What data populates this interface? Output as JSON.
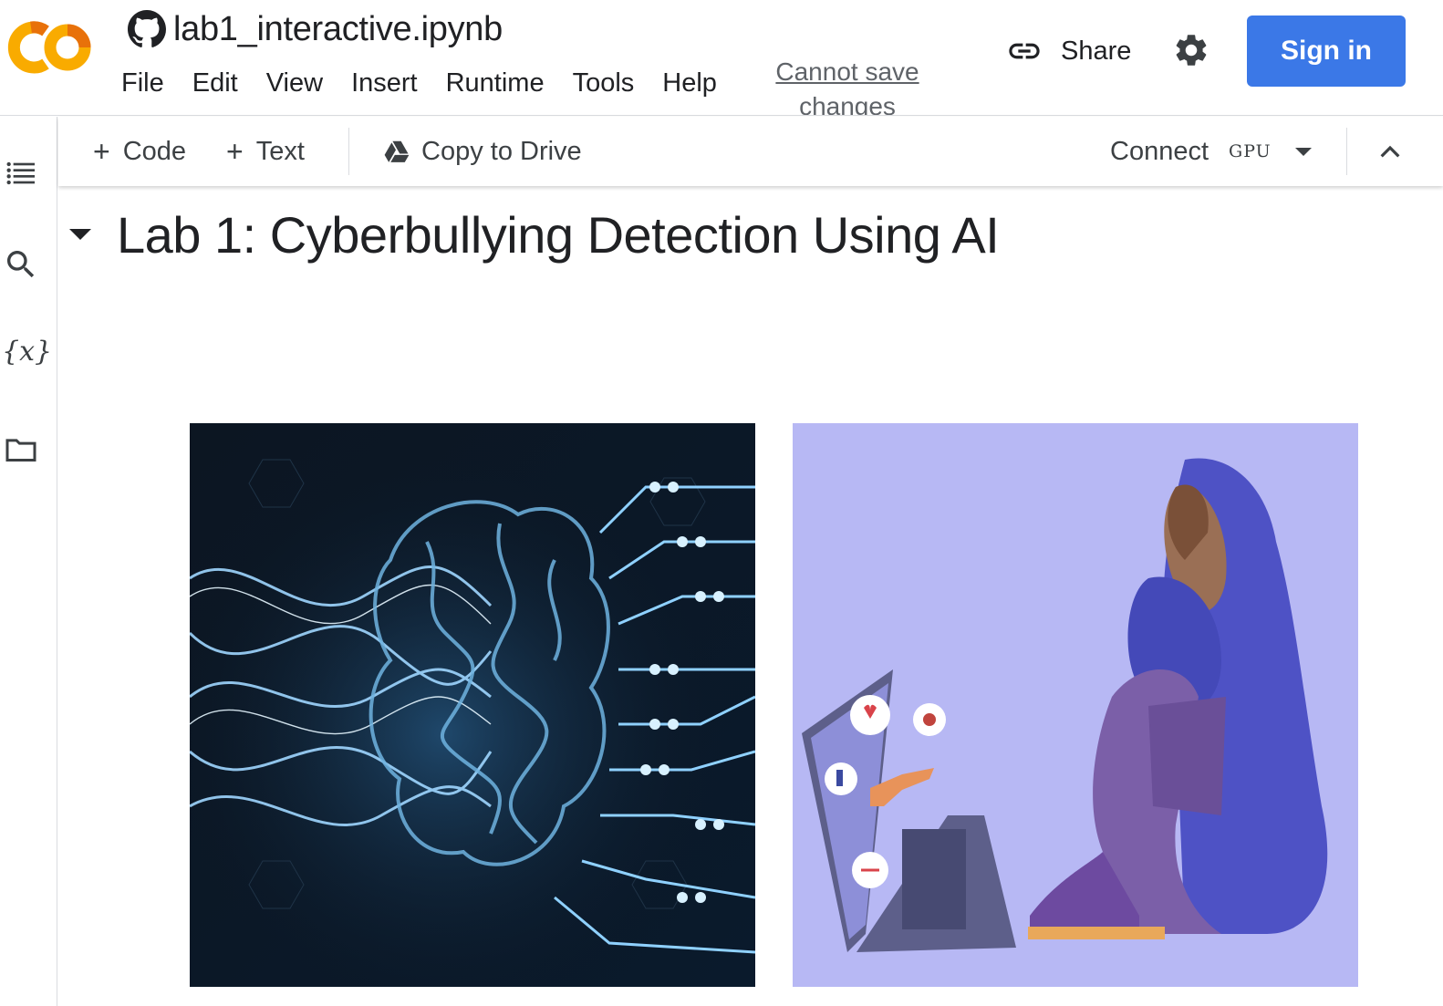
{
  "app": {
    "logo": "colab-logo"
  },
  "notebook": {
    "title": "lab1_interactive.ipynb",
    "source_icon": "github-icon"
  },
  "menu": [
    "File",
    "Edit",
    "View",
    "Insert",
    "Runtime",
    "Tools",
    "Help"
  ],
  "save_status": "Cannot save changes",
  "header": {
    "share_label": "Share",
    "signin_label": "Sign in",
    "signin_color": "#3b78e7"
  },
  "sidebar": {
    "items": [
      "toc-icon",
      "search-icon",
      "variables-icon",
      "folder-icon"
    ],
    "variables_glyph": "{x}"
  },
  "toolbar": {
    "code_label": "Code",
    "text_label": "Text",
    "copy_label": "Copy to Drive",
    "connect_label": "Connect",
    "runtime_type": "GPU"
  },
  "content": {
    "heading": "Lab 1: Cyberbullying Detection Using AI",
    "images": [
      "ai-brain-circuit-image",
      "cyberbullying-illustration-image"
    ]
  }
}
